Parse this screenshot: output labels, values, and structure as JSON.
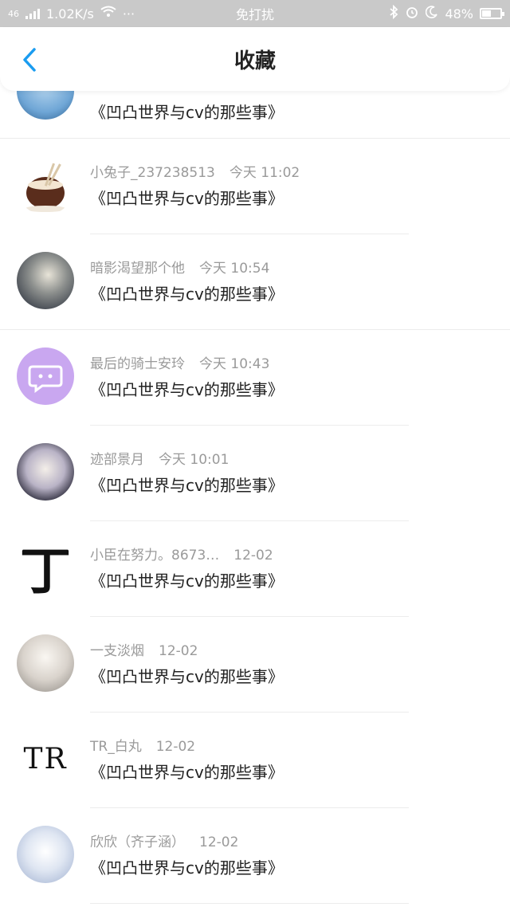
{
  "status_bar": {
    "network": "46",
    "speed": "1.02K/s",
    "more": "···",
    "mode": "免打扰",
    "battery": "48%"
  },
  "header": {
    "title": "收藏"
  },
  "first_row": {
    "content": "《凹凸世界与cv的那些事》"
  },
  "items": [
    {
      "name": "小兔子_237238513",
      "time": "今天 11:02",
      "content": "《凹凸世界与cv的那些事》"
    },
    {
      "name": "暗影渴望那个他",
      "time": "今天 10:54",
      "content": "《凹凸世界与cv的那些事》"
    },
    {
      "name": "最后的骑士安玲",
      "time": "今天 10:43",
      "content": "《凹凸世界与cv的那些事》"
    },
    {
      "name": "迹部景月",
      "time": "今天 10:01",
      "content": "《凹凸世界与cv的那些事》"
    },
    {
      "name": "小臣在努力。8673…",
      "time": "12-02",
      "content": "《凹凸世界与cv的那些事》"
    },
    {
      "name": "一支淡烟",
      "time": "12-02",
      "content": "《凹凸世界与cv的那些事》"
    },
    {
      "name": "TR_白丸",
      "time": "12-02",
      "content": "《凹凸世界与cv的那些事》"
    },
    {
      "name": "欣欣（齐子涵）",
      "time": "12-02",
      "content": "《凹凸世界与cv的那些事》"
    }
  ],
  "avatar_texts": {
    "ding": "丁",
    "tr": "TR"
  },
  "colors": {
    "accent": "#1a9cf0",
    "status_bar": "#c9c9c9",
    "chat_avatar": "#c9a7f0"
  }
}
